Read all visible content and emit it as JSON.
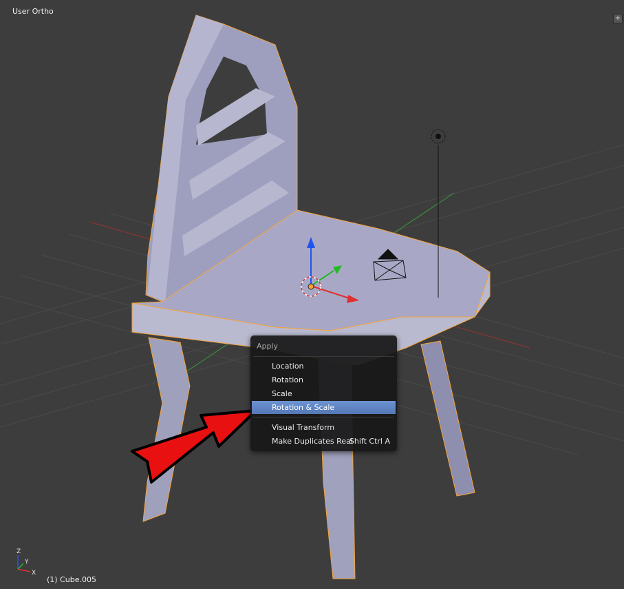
{
  "viewport": {
    "view_label": "User Ortho",
    "object_label": "(1) Cube.005",
    "corner_widget_icon": "plus-icon"
  },
  "menu": {
    "title": "Apply",
    "items": [
      {
        "label": "Location",
        "shortcut": "",
        "active": false
      },
      {
        "label": "Rotation",
        "shortcut": "",
        "active": false
      },
      {
        "label": "Scale",
        "shortcut": "",
        "active": false
      },
      {
        "label": "Rotation & Scale",
        "shortcut": "",
        "active": true
      },
      {
        "label": "Visual Transform",
        "shortcut": "",
        "active": false
      },
      {
        "label": "Make Duplicates Real",
        "shortcut": "Shift Ctrl A",
        "active": false
      }
    ]
  },
  "axes": {
    "x_label": "X",
    "y_label": "Y",
    "z_label": "Z",
    "x_color": "#e03030",
    "y_color": "#22bb22",
    "z_color": "#2255ee"
  },
  "colors": {
    "background": "#3d3d3d",
    "mesh_face": "#a7a7c4",
    "selection_outline": "#f5a43a",
    "menu_highlight": "#5f86c8"
  }
}
